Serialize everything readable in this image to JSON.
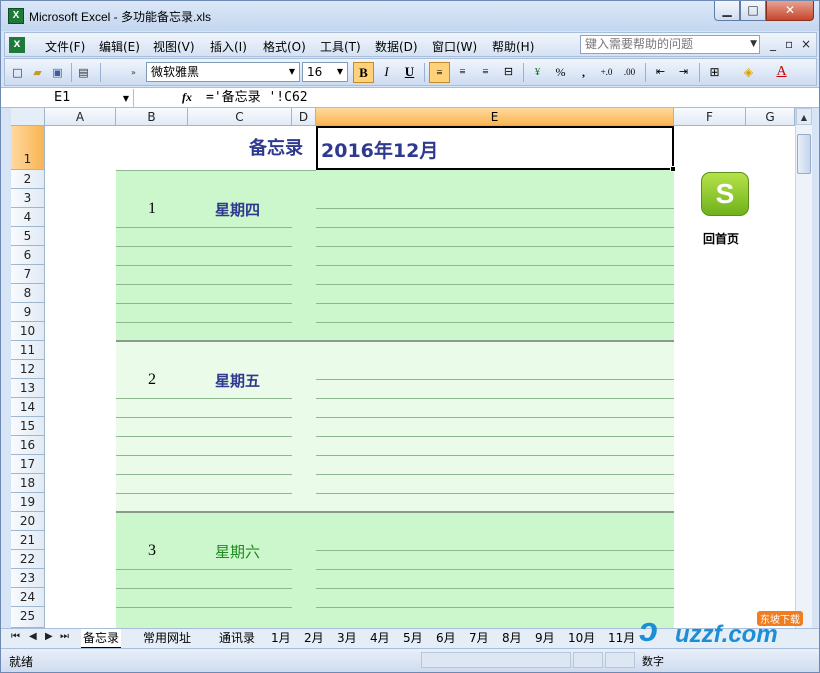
{
  "window": {
    "title": "Microsoft Excel - 多功能备忘录.xls",
    "app_icon": "excel-icon",
    "minimize": "▁",
    "maximize": "□",
    "close": "✕"
  },
  "menubar": {
    "items": [
      "文件(F)",
      "编辑(E)",
      "视图(V)",
      "插入(I)",
      "格式(O)",
      "工具(T)",
      "数据(D)",
      "窗口(W)",
      "帮助(H)"
    ],
    "help_placeholder": "键入需要帮助的问题",
    "doc_minimize": "_",
    "doc_restore": "▫",
    "doc_close": "×"
  },
  "toolbar": {
    "font_name": "微软雅黑",
    "font_size": "16",
    "bold": "B",
    "italic": "I",
    "underline": "U",
    "percent": "%",
    "comma": ",",
    "increase_decimal": "+.0",
    "decrease_decimal": ".00"
  },
  "formula_bar": {
    "cell_ref": "E1",
    "fx": "fx",
    "formula": "='备忘录 '!C62"
  },
  "columns": [
    "A",
    "B",
    "C",
    "D",
    "E",
    "F",
    "G"
  ],
  "selected_column": "E",
  "rows": [
    "1",
    "2",
    "3",
    "4",
    "5",
    "6",
    "7",
    "8",
    "9",
    "10",
    "11",
    "12",
    "13",
    "14",
    "15",
    "16",
    "17",
    "18",
    "19",
    "20",
    "21",
    "22",
    "23",
    "24",
    "25"
  ],
  "sheet": {
    "memo_label": "备忘录",
    "month": "2016年12月",
    "days": [
      {
        "num": "1",
        "weekday": "星期四"
      },
      {
        "num": "2",
        "weekday": "星期五"
      },
      {
        "num": "3",
        "weekday": "星期六"
      }
    ],
    "home_icon": "s-home-icon",
    "home_label": "回首页"
  },
  "sheet_tabs": {
    "nav": [
      "⏮",
      "◀",
      "▶",
      "⏭"
    ],
    "tabs": [
      "备忘录",
      "常用网址",
      "通讯录",
      "1月",
      "2月",
      "3月",
      "4月",
      "5月",
      "6月",
      "7月",
      "8月",
      "9月",
      "10月",
      "11月"
    ],
    "active": "备忘录"
  },
  "status_bar": {
    "status": "就绪",
    "mode": "数字"
  },
  "watermark": {
    "text": "uzzf.com",
    "badge": "东坡下载"
  }
}
